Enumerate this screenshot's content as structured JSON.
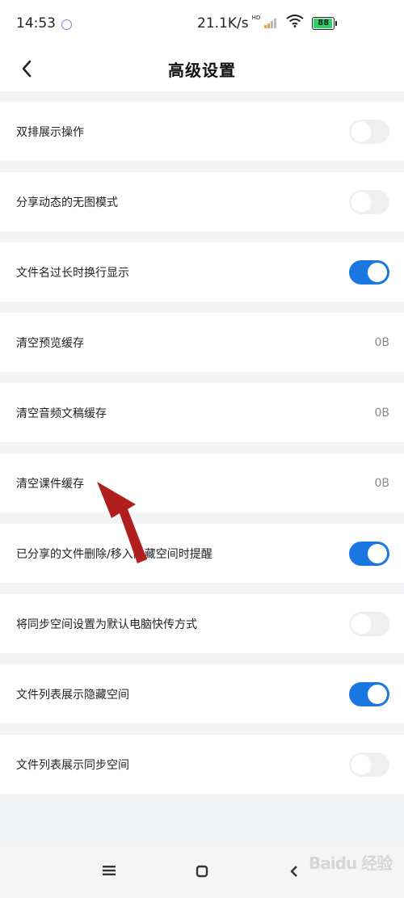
{
  "status_bar": {
    "time": "14:53",
    "network_speed": "21.1K/s",
    "hd_label": "HD",
    "battery_level": "88",
    "battery_color": "#2ed164"
  },
  "header": {
    "title": "高级设置",
    "back_icon": "chevron-left-icon"
  },
  "settings": [
    {
      "label": "双排展示操作",
      "type": "toggle",
      "enabled": false
    },
    {
      "label": "分享动态的无图模式",
      "type": "toggle",
      "enabled": false
    },
    {
      "label": "文件名过长时换行显示",
      "type": "toggle",
      "enabled": true
    },
    {
      "label": "清空预览缓存",
      "type": "value",
      "value": "0B"
    },
    {
      "label": "清空音频文稿缓存",
      "type": "value",
      "value": "0B"
    },
    {
      "label": "清空课件缓存",
      "type": "value",
      "value": "0B"
    },
    {
      "label": "已分享的文件删除/移入隐藏空间时提醒",
      "type": "toggle",
      "enabled": true
    },
    {
      "label": "将同步空间设置为默认电脑快传方式",
      "type": "toggle",
      "enabled": false
    },
    {
      "label": "文件列表展示隐藏空间",
      "type": "toggle",
      "enabled": true
    },
    {
      "label": "文件列表展示同步空间",
      "type": "toggle",
      "enabled": false
    }
  ],
  "colors": {
    "accent": "#1a76e0",
    "toggle_off": "#efeff0",
    "annotation_arrow": "#b01e1e"
  },
  "nav_bar": {
    "buttons": [
      "menu-icon",
      "home-square-icon",
      "back-triangle-icon"
    ]
  },
  "watermark": {
    "text": "Baidu 经验"
  }
}
